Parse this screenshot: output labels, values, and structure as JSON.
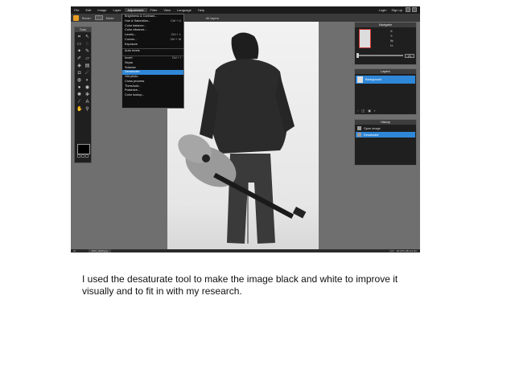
{
  "menubar": {
    "items": [
      "File",
      "Edit",
      "Image",
      "Layer",
      "Adjustment",
      "Filter",
      "View",
      "Language",
      "Help"
    ],
    "active_index": 4,
    "login": "Login",
    "signup": "Sign up"
  },
  "options_bar": {
    "tool_label": "Brush:",
    "mode_label": "Mode",
    "right_text": "All layers"
  },
  "tools_panel": {
    "title": "Tools"
  },
  "adjustment_menu": {
    "items": [
      {
        "label": "Brightness & Contrast...",
        "shortcut": ""
      },
      {
        "label": "Hue & Saturation...",
        "shortcut": "Ctrl + U"
      },
      {
        "label": "Color balance...",
        "shortcut": ""
      },
      {
        "label": "Color vibrance...",
        "shortcut": ""
      },
      {
        "label": "Levels...",
        "shortcut": "Ctrl + L"
      },
      {
        "label": "Curves...",
        "shortcut": "Ctrl + M"
      },
      {
        "label": "Exposure",
        "shortcut": ""
      },
      {
        "label": "",
        "shortcut": ""
      },
      {
        "label": "Auto levels",
        "shortcut": ""
      },
      {
        "label": "",
        "shortcut": ""
      },
      {
        "label": "Invert",
        "shortcut": "Ctrl + I"
      },
      {
        "label": "Sepia",
        "shortcut": ""
      },
      {
        "label": "Solarize",
        "shortcut": ""
      },
      {
        "label": "Desaturate",
        "shortcut": ""
      },
      {
        "label": "Old photo",
        "shortcut": ""
      },
      {
        "label": "Cross process",
        "shortcut": ""
      },
      {
        "label": "Threshold...",
        "shortcut": ""
      },
      {
        "label": "Posterize...",
        "shortcut": ""
      },
      {
        "label": "Color lookup...",
        "shortcut": ""
      }
    ],
    "selected_index": 13
  },
  "navigator": {
    "title": "Navigator",
    "x_label": "X:",
    "y_label": "Y:",
    "w_label": "W:",
    "h_label": "H:",
    "zoom": "21"
  },
  "layers": {
    "title": "Layers",
    "layer_name": "Background"
  },
  "history": {
    "title": "History",
    "items": [
      "Open image",
      "Desaturate"
    ],
    "selected_index": 1
  },
  "statusbar": {
    "left": "21",
    "tab": "DSC_0009.jpg",
    "right": "(-67 : -90 FPS 384.24 kb)"
  },
  "caption": "I used the desaturate tool to make the image black and white to improve it visually and to fit in with my research.",
  "colors": {
    "accent": "#2f87d8",
    "menubar": "#1c1c1c",
    "workspace": "#6f6f6f"
  }
}
